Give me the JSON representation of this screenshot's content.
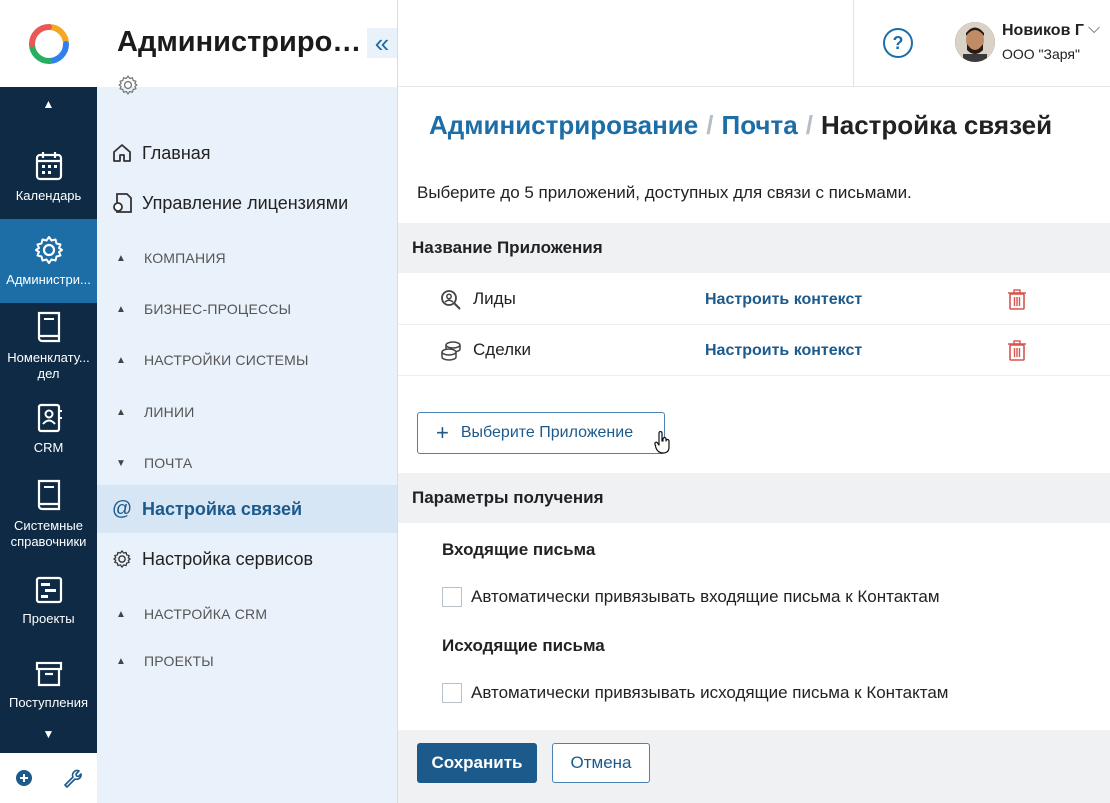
{
  "nav": {
    "items": [
      {
        "label": "Календарь",
        "icon": "calendar-icon"
      },
      {
        "label": "Администри...",
        "icon": "gear-icon"
      },
      {
        "label": "Номенклату... дел",
        "icon": "book-icon"
      },
      {
        "label": "CRM",
        "icon": "contact-book-icon"
      },
      {
        "label": "Системные справочники",
        "icon": "book-icon"
      },
      {
        "label": "Проекты",
        "icon": "projects-icon"
      },
      {
        "label": "Поступления",
        "icon": "inbox-box-icon"
      }
    ],
    "bottom": {
      "add_icon": "plus-circle-icon",
      "tools_icon": "wrench-icon"
    }
  },
  "sidebar": {
    "title": "Администрирование",
    "items": [
      {
        "label": "Главная",
        "icon": "home-icon"
      },
      {
        "label": "Управление лицензиями",
        "icon": "license-icon"
      }
    ],
    "sections": [
      {
        "label": "КОМПАНИЯ",
        "state": "collapsed"
      },
      {
        "label": "БИЗНЕС-ПРОЦЕССЫ",
        "state": "collapsed"
      },
      {
        "label": "НАСТРОЙКИ СИСТЕМЫ",
        "state": "collapsed"
      },
      {
        "label": "ЛИНИИ",
        "state": "collapsed"
      },
      {
        "label": "ПОЧТА",
        "state": "expanded"
      },
      {
        "label": "НАСТРОЙКА CRM",
        "state": "collapsed"
      },
      {
        "label": "ПРОЕКТЫ",
        "state": "collapsed"
      }
    ],
    "mail_items": [
      {
        "label": "Настройка связей",
        "icon": "at-icon",
        "active": true
      },
      {
        "label": "Настройка сервисов",
        "icon": "gear-icon",
        "active": false
      }
    ]
  },
  "header": {
    "help": "?",
    "user_name": "Новиков Г",
    "user_org": "ООО \"Заря\""
  },
  "breadcrumb": {
    "items": [
      "Администрирование",
      "Почта"
    ],
    "current": "Настройка связей",
    "separator": "/"
  },
  "intro": "Выберите до 5 приложений, доступных для связи с письмами.",
  "apps": {
    "header": "Название Приложения",
    "rows": [
      {
        "name": "Лиды",
        "icon": "leads-search-icon",
        "link": "Настроить контекст"
      },
      {
        "name": "Сделки",
        "icon": "coins-stack-icon",
        "link": "Настроить контекст"
      }
    ],
    "add_button": "Выберите Приложение"
  },
  "params": {
    "header": "Параметры получения",
    "incoming_title": "Входящие письма",
    "incoming_checkbox": "Автоматически привязывать входящие письма к Контактам",
    "outgoing_title": "Исходящие письма",
    "outgoing_checkbox": "Автоматически привязывать исходящие письма к Контактам"
  },
  "footer": {
    "save": "Сохранить",
    "cancel": "Отмена"
  },
  "colors": {
    "nav_bg": "#0f2a44",
    "nav_active": "#1d6ea6",
    "sidebar_bg": "#e9f1fa",
    "accent": "#1d5a8c",
    "delete": "#d9534f"
  }
}
